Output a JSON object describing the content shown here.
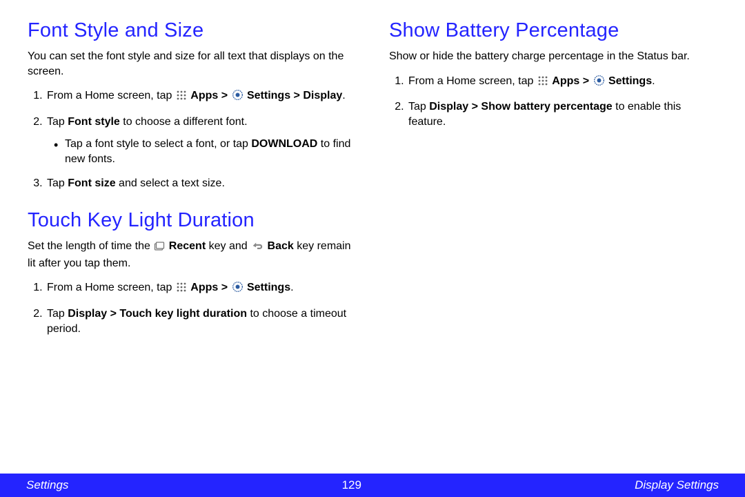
{
  "left": {
    "section1": {
      "heading": "Font Style and Size",
      "intro": "You can set the font style and size for all text that displays on the screen.",
      "step1_a": "From a Home screen, tap ",
      "step1_apps": "Apps > ",
      "step1_settings": "Settings > Display",
      "step1_dot": ".",
      "step2_a": "Tap ",
      "step2_b": "Font style",
      "step2_c": " to choose a different font.",
      "sub1_a": "Tap a font style to select a font, or tap ",
      "sub1_b": "DOWNLOAD",
      "sub1_c": " to find new fonts.",
      "step3_a": "Tap ",
      "step3_b": "Font size",
      "step3_c": " and select a text size."
    },
    "section2": {
      "heading": "Touch Key Light Duration",
      "intro_a": "Set the length of time the ",
      "intro_recent": "Recent",
      "intro_b": " key and ",
      "intro_back": "Back",
      "intro_c": " key remain lit after you tap them.",
      "step1_a": "From a Home screen, tap ",
      "step1_apps": "Apps > ",
      "step1_settings": "Settings",
      "step1_dot": ".",
      "step2_a": "Tap ",
      "step2_b": "Display > Touch key light duration",
      "step2_c": " to choose a timeout period."
    }
  },
  "right": {
    "section1": {
      "heading": "Show Battery Percentage",
      "intro": "Show or hide the battery charge percentage in the Status bar.",
      "step1_a": "From a Home screen, tap ",
      "step1_apps": "Apps > ",
      "step1_settings": "Settings",
      "step1_dot": ".",
      "step2_a": "Tap ",
      "step2_b": "Display > Show battery percentage",
      "step2_c": " to enable this feature."
    }
  },
  "footer": {
    "left": "Settings",
    "center": "129",
    "right": "Display Settings"
  }
}
